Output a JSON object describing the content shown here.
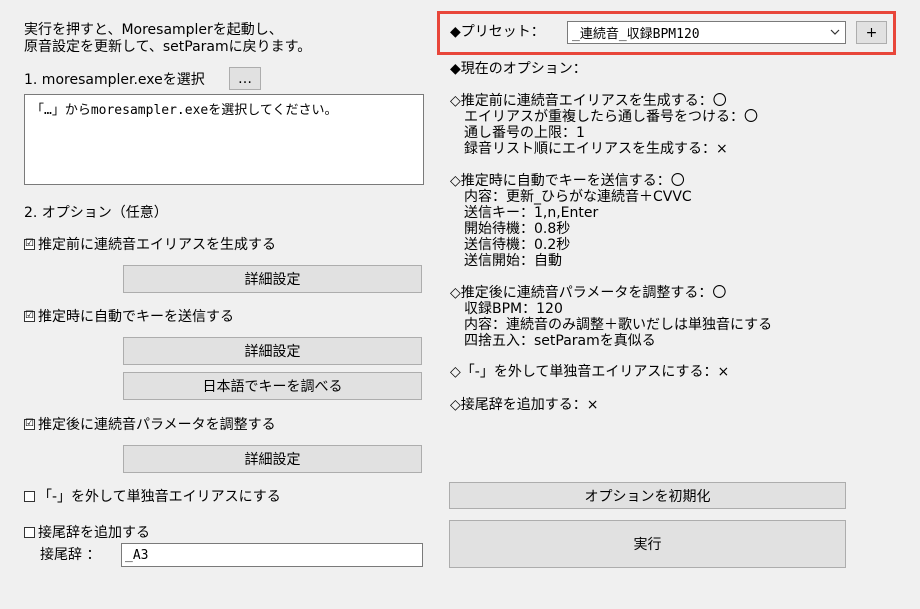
{
  "intro": {
    "line1": "実行を押すと、Moresamplerを起動し、",
    "line2": "原音設定を更新して、setParamに戻ります。"
  },
  "step1": {
    "label": "1. moresampler.exeを選択",
    "browse_label": "…",
    "path_text": "「…」からmoresampler.exeを選択してください。"
  },
  "step2": {
    "label": "2. オプション（任意）"
  },
  "options_left": {
    "pre_alias": {
      "label": "推定前に連続音エイリアスを生成する",
      "checked": "☑"
    },
    "detail1": "詳細設定",
    "auto_key": {
      "label": "推定時に自動でキーを送信する",
      "checked": "☑"
    },
    "detail2": "詳細設定",
    "check_key": "日本語でキーを調べる",
    "post_adjust": {
      "label": "推定後に連続音パラメータを調整する",
      "checked": "☑"
    },
    "detail3": "詳細設定",
    "remove_dash": {
      "label": "「-」を外して単独音エイリアスにする",
      "checked": ""
    },
    "suffix": {
      "label": "接尾辞を追加する",
      "checked": ""
    },
    "suffix_field_label": "接尾辞 ：",
    "suffix_value": "_A3"
  },
  "preset": {
    "label": "◆プリセット：",
    "selected": "_連続音_収録BPM120",
    "add_label": "+"
  },
  "current": {
    "heading": "◆現在のオプション：",
    "pre_alias": "◇推定前に連続音エイリアスを生成する：〇",
    "pre_alias_1": "エイリアスが重複したら通し番号をつける：〇",
    "pre_alias_2": "通し番号の上限：1",
    "pre_alias_3": "録音リスト順にエイリアスを生成する：×",
    "auto_key": "◇推定時に自動でキーを送信する：〇",
    "auto_key_1": "内容：更新_ひらがな連続音＋CVVC",
    "auto_key_2": "送信キー：1,n,Enter",
    "auto_key_3": "開始待機：0.8秒",
    "auto_key_4": "送信待機：0.2秒",
    "auto_key_5": "送信開始：自動",
    "post_adjust": "◇推定後に連続音パラメータを調整する：〇",
    "post_adjust_1": "収録BPM：120",
    "post_adjust_2": "内容：連続音のみ調整＋歌いだしは単独音にする",
    "post_adjust_3": "四捨五入：setParamを真似る",
    "remove_dash": "◇「-」を外して単独音エイリアスにする：×",
    "suffix": "◇接尾辞を追加する：×"
  },
  "actions": {
    "reset": "オプションを初期化",
    "run": "実行"
  },
  "colors": {
    "highlight": "#e8463a",
    "button_bg": "#e1e1e1",
    "window_bg": "#f0f0f0"
  }
}
